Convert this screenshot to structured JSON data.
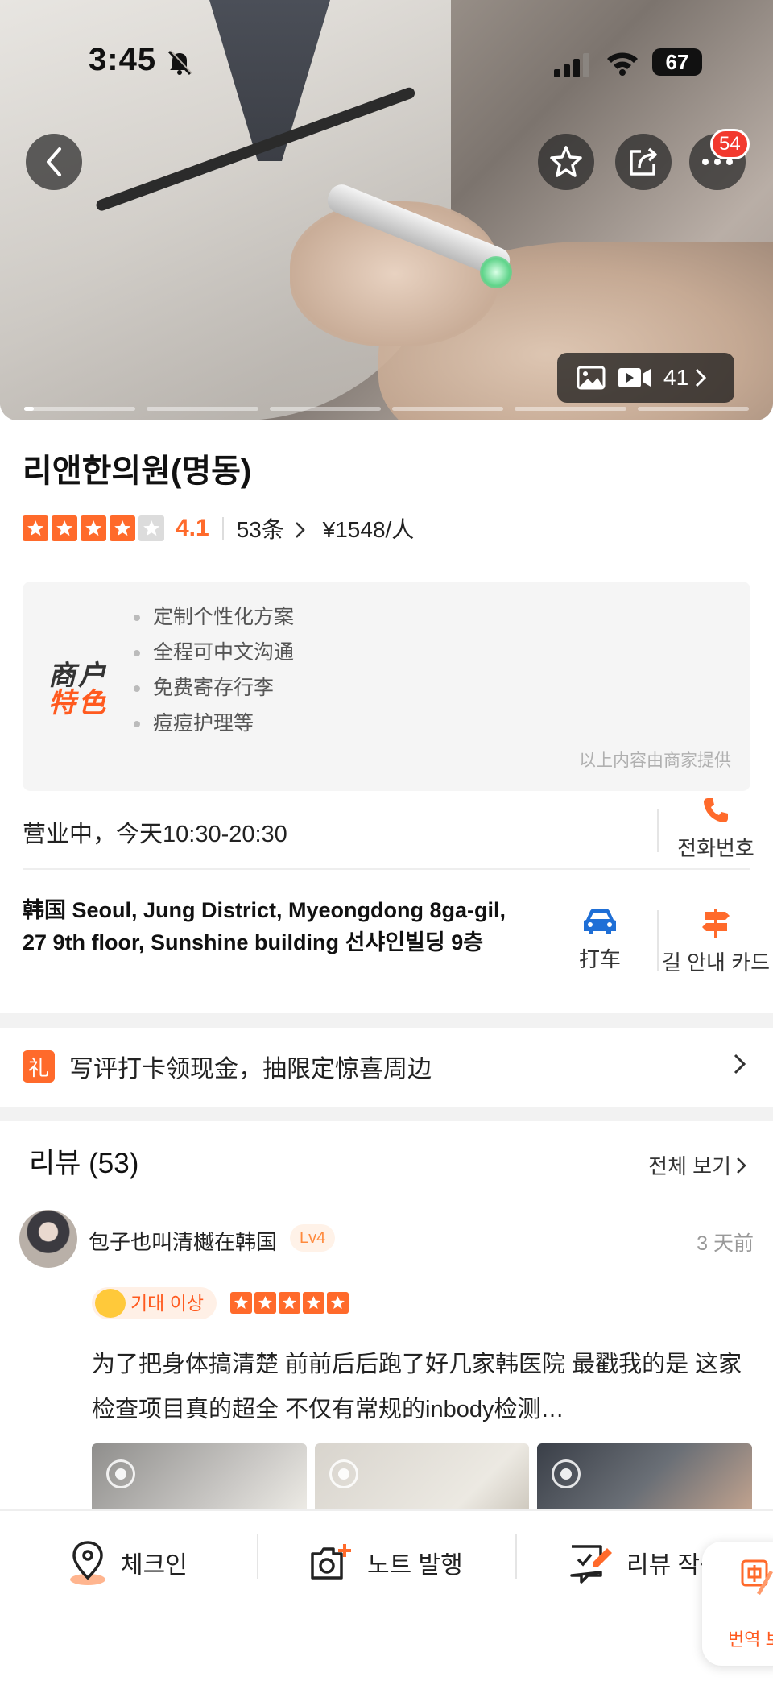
{
  "status_bar": {
    "time": "3:45",
    "battery": "67"
  },
  "hero": {
    "media_count": "41",
    "notification_count": "54",
    "slide_count": 6
  },
  "shop": {
    "name": "리앤한의원(명동)",
    "rating": "4.1",
    "rating_value": 4.1,
    "review_count_label": "53条",
    "price": "¥1548/人"
  },
  "features": {
    "logo_line1": "商户",
    "logo_line2": "特色",
    "items": [
      "定制个性化方案",
      "全程可中文沟通",
      "免费寄存行李",
      "痘痘护理等"
    ],
    "note": "以上内容由商家提供"
  },
  "hours": "营业中，今天10:30-20:30",
  "call_label": "전화번호",
  "address": "韩国 Seoul, Jung District, Myeongdong 8ga-gil, 27 9th floor, Sunshine building 선샤인빌딩 9층",
  "taxi_label": "打车",
  "guide_label": "길 안내 카드",
  "promo": {
    "icon_text": "礼",
    "text": "写评打卡领现金，抽限定惊喜周边"
  },
  "reviews": {
    "header": "리뷰 (53)",
    "view_all": "전체 보기",
    "items": [
      {
        "user": "包子也叫清樾在韩国",
        "level": "Lv4",
        "time": "3 天前",
        "tag": "기대 이상",
        "stars": 5,
        "text": "为了把身体搞清楚 前前后后跑了好几家韩医院 最戳我的是 这家检查项目真的超全 不仅有常规的inbody检测…"
      }
    ]
  },
  "bottom_bar": {
    "checkin": "체크인",
    "note": "노트 발행",
    "review": "리뷰 작성",
    "translate": "번역 보기"
  },
  "colors": {
    "accent": "#ff6a2b",
    "badge": "#f2392e",
    "taxi_icon": "#1f6fd6"
  }
}
